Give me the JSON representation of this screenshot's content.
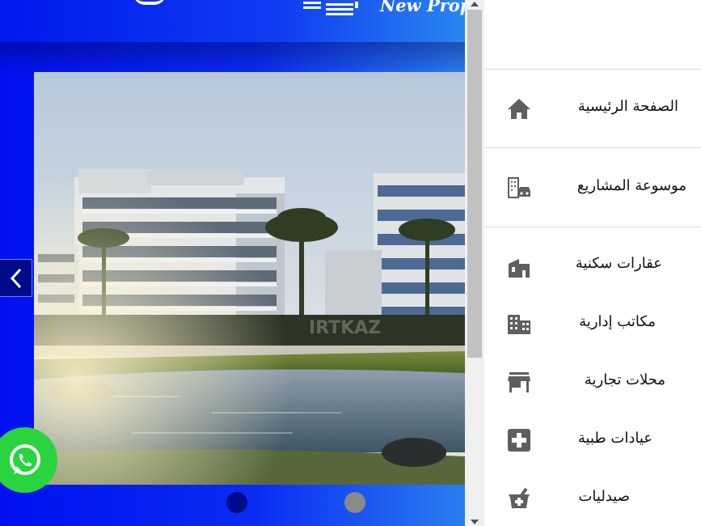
{
  "header": {
    "logo_text": "New Prop"
  },
  "slider": {
    "watermark": "IRTKAZ",
    "prev_icon": "chevron-left-icon",
    "dots": [
      {
        "state": "active",
        "color": "#000b8c"
      },
      {
        "state": "inactive",
        "color": "#8a8a8a"
      }
    ]
  },
  "whatsapp": {
    "icon": "whatsapp-icon",
    "color": "#2ad43f"
  },
  "menu": {
    "items": [
      {
        "label": "الصفحة الرئيسية",
        "icon": "home-icon"
      },
      {
        "label": "موسوعة المشاريع",
        "icon": "city-car-icon"
      },
      {
        "label": "عقارات سكنية",
        "icon": "residential-building-icon"
      },
      {
        "label": "مكاتب إدارية",
        "icon": "office-building-icon"
      },
      {
        "label": "محلات تجارية",
        "icon": "store-icon"
      },
      {
        "label": "عيادات طبية",
        "icon": "medical-plus-icon"
      },
      {
        "label": "صيدليات",
        "icon": "pharmacy-mortar-icon"
      }
    ]
  },
  "colors": {
    "brand_blue": "#0010f0",
    "dark_navy": "#000b8c",
    "icon_gray": "#5f5f5f"
  }
}
